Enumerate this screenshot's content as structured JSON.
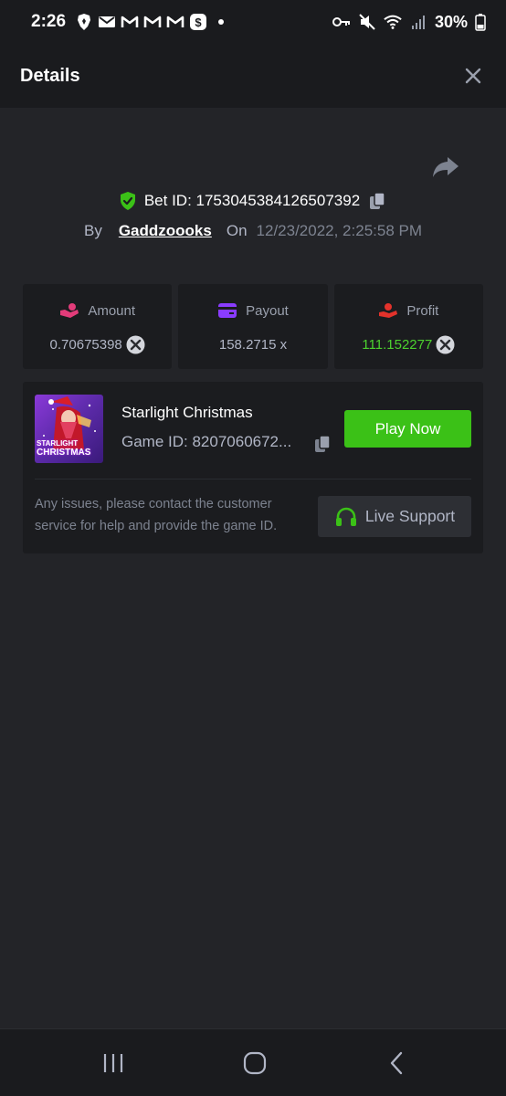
{
  "status_bar": {
    "time": "2:26",
    "battery": "30%",
    "left_icons": [
      "brave-icon",
      "mail-icon",
      "gmail-icon",
      "gmail-icon",
      "gmail-icon",
      "cash-app-icon",
      "dot-icon"
    ],
    "right_icons": [
      "key-icon",
      "mute-icon",
      "wifi-icon",
      "signal-icon",
      "battery-icon"
    ]
  },
  "header": {
    "title": "Details",
    "close_icon": "close-icon"
  },
  "bet": {
    "id_text": "Bet ID: 1753045384126507392",
    "by_label": "By",
    "username": "Gaddzoooks",
    "on_label": "On",
    "date": "12/23/2022, 2:25:58 PM"
  },
  "stats": {
    "amount": {
      "label": "Amount",
      "value": "0.70675398",
      "icon": "hand-coins-icon"
    },
    "payout": {
      "label": "Payout",
      "value": "158.2715 x",
      "icon": "wallet-card-icon"
    },
    "profit": {
      "label": "Profit",
      "value": "111.152277",
      "icon": "hand-profit-icon"
    }
  },
  "game": {
    "name": "Starlight Christmas",
    "id_text": "Game ID: 8207060672...",
    "play_label": "Play Now",
    "thumb_line1": "STARLIGHT",
    "thumb_line2": "CHRISTMAS",
    "support_text": "Any issues, please contact the customer service for help and provide the game ID.",
    "support_label": "Live Support"
  },
  "colors": {
    "background": "#232428",
    "card": "#1b1c1f",
    "accent_green": "#3bc117",
    "profit_green": "#4cd12e",
    "shield_green": "#3bc117"
  }
}
